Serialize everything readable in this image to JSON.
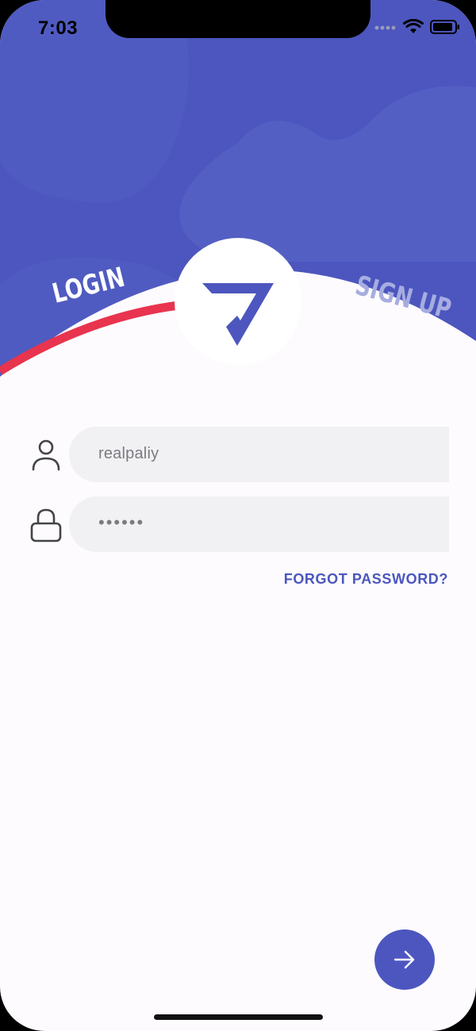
{
  "status_bar": {
    "time": "7:03"
  },
  "tabs": {
    "login": "LOGIN",
    "signup": "SIGN UP"
  },
  "form": {
    "username_value": "realpaliy",
    "password_masked": "••••••",
    "forgot_password": "FORGOT PASSWORD?"
  },
  "icons": {
    "user": "user-icon",
    "lock": "lock-icon",
    "submit": "arrow-right-icon",
    "logo": "triangle-check-logo",
    "wifi": "wifi-icon",
    "battery": "battery-icon",
    "signal": "signal-icon"
  },
  "colors": {
    "primary": "#4C56BE",
    "accent_red": "#E8344E",
    "background": "#FDFBFE",
    "field_bg": "#F1F0F3",
    "tab_inactive": "#A7ADE0"
  }
}
